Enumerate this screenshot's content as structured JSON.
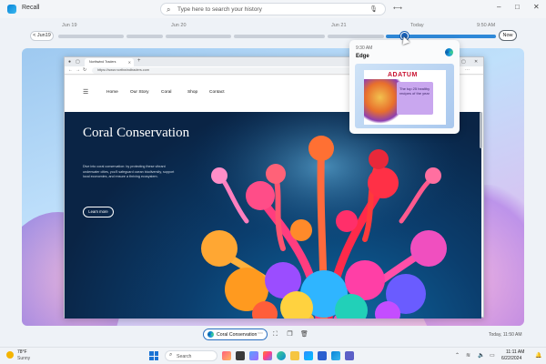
{
  "app": {
    "title": "Recall",
    "search_placeholder": "Type here to search your history"
  },
  "window_controls": {
    "minimize": "–",
    "maximize": "□",
    "close": "✕"
  },
  "timeline": {
    "back_label": "< Jun19",
    "dates": [
      "Jun 19",
      "Jun 20",
      "Jun 21",
      "Today"
    ],
    "hover_time": "9:50 AM",
    "now_label": "Now"
  },
  "preview": {
    "time": "9:30 AM",
    "app": "Edge",
    "brand": "ADATUM",
    "card_text": "The top 25 healthy recipes of the year"
  },
  "browser": {
    "tab_title": "Northwind Traders",
    "url": "https://www.northwindtraders.com",
    "nav": [
      "Home",
      "Our Story",
      "Coral",
      "Shop",
      "Contact"
    ],
    "hero_title": "Coral Conservation",
    "hero_body": "Dive into coral conservation: by protecting these vibrant underwater cities, you'll safeguard ocean biodiversity, support local economies, and ensure a thriving ecosystem.",
    "hero_button": "Learn more"
  },
  "action_bar": {
    "pill_label": "Coral Conservation",
    "snapshot_time": "Today, 11:50 AM"
  },
  "taskbar": {
    "temp": "78°F",
    "condition": "Sunny",
    "search": "Search",
    "time": "11:11 AM",
    "date": "6/22/2024"
  },
  "colors": {
    "accent": "#1a5fb4",
    "timeline_active": "#2e88d8",
    "hero_bg": "#0b3e6e"
  }
}
